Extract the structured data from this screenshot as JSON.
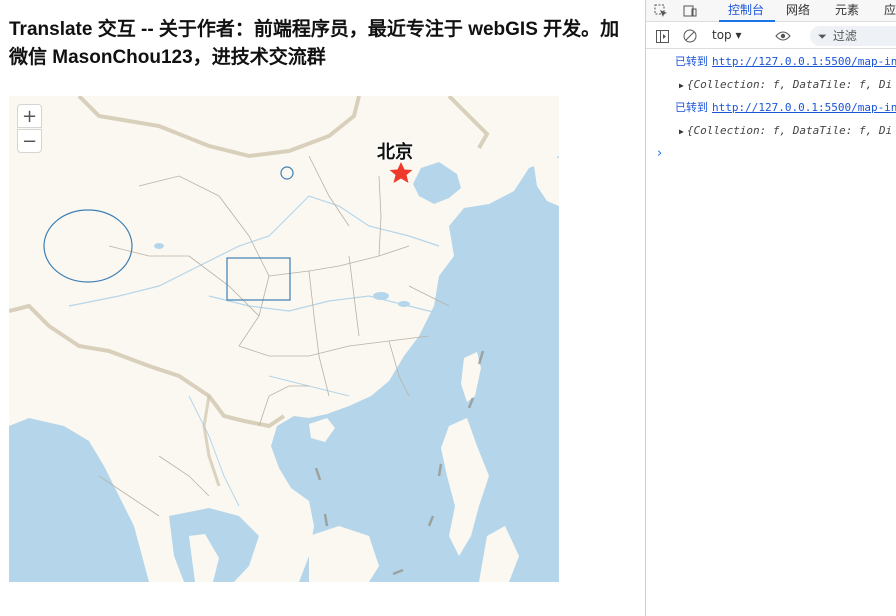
{
  "page": {
    "title": "Translate 交互 -- 关于作者：前端程序员，最近专注于 webGIS 开发。加微信 MasonChou123，进技术交流群"
  },
  "map": {
    "zoom_in_label": "+",
    "zoom_out_label": "−",
    "city_label": "北京",
    "marker_icon": "star-icon",
    "colors": {
      "land": "#fbf8f2",
      "water": "#b5d6ea",
      "border": "#c4bca6",
      "province": "#b8b2a6",
      "feature_stroke": "#4a8ab8",
      "marker": "#ee3a2a"
    }
  },
  "devtools": {
    "tabs": [
      "控制台",
      "网络",
      "元素",
      "应"
    ],
    "active_tab": "控制台",
    "context": "top ▾",
    "filter_placeholder": "过滤",
    "logs": [
      {
        "type": "navigation",
        "text": "已转到",
        "link": "http://127.0.0.1:5500/map-in"
      },
      {
        "type": "object",
        "text": "{Collection: f, DataTile: f, Di"
      },
      {
        "type": "navigation",
        "text": "已转到",
        "link": "http://127.0.0.1:5500/map-in"
      },
      {
        "type": "object",
        "text": "{Collection: f, DataTile: f, Di"
      }
    ],
    "prompt_symbol": "›"
  }
}
